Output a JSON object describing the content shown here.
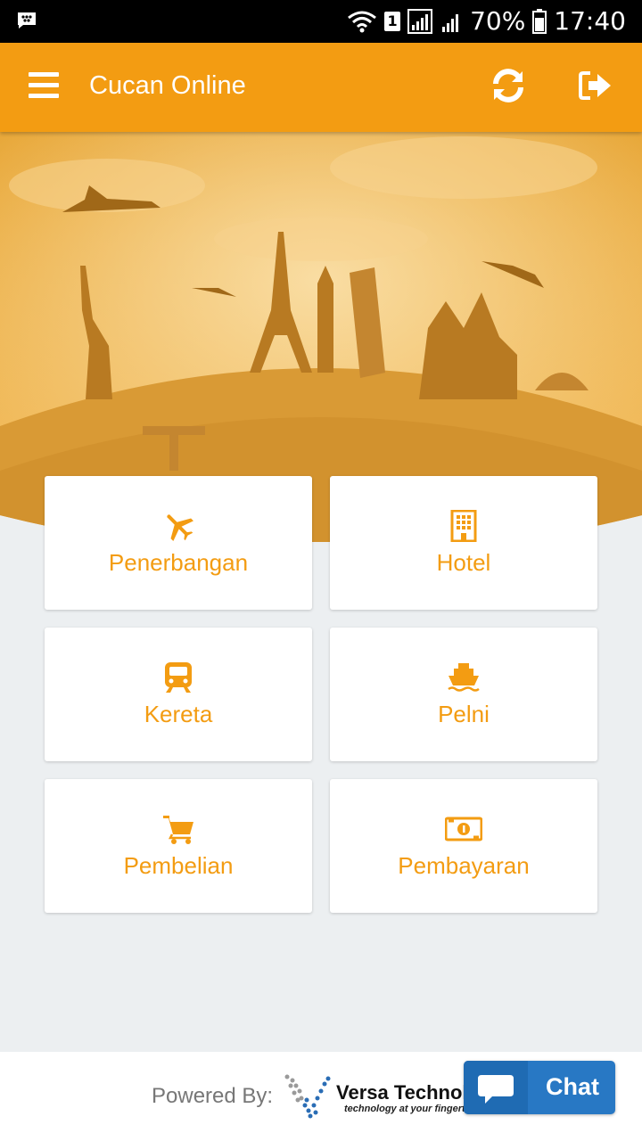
{
  "status_bar": {
    "battery": "70%",
    "time": "17:40",
    "sim_slot": "1"
  },
  "app_bar": {
    "title": "Cucan Online"
  },
  "menu": [
    {
      "label": "Penerbangan",
      "icon": "airplane-icon"
    },
    {
      "label": "Hotel",
      "icon": "building-icon"
    },
    {
      "label": "Kereta",
      "icon": "train-icon"
    },
    {
      "label": "Pelni",
      "icon": "ship-icon"
    },
    {
      "label": "Pembelian",
      "icon": "cart-icon"
    },
    {
      "label": "Pembayaran",
      "icon": "money-icon"
    }
  ],
  "footer": {
    "powered_by": "Powered By:",
    "company": "Versa Technology",
    "tagline": "technology at your fingertips"
  },
  "chat": {
    "label": "Chat"
  },
  "colors": {
    "primary": "#f39c12",
    "chat": "#2878c4",
    "background": "#eceff1"
  }
}
